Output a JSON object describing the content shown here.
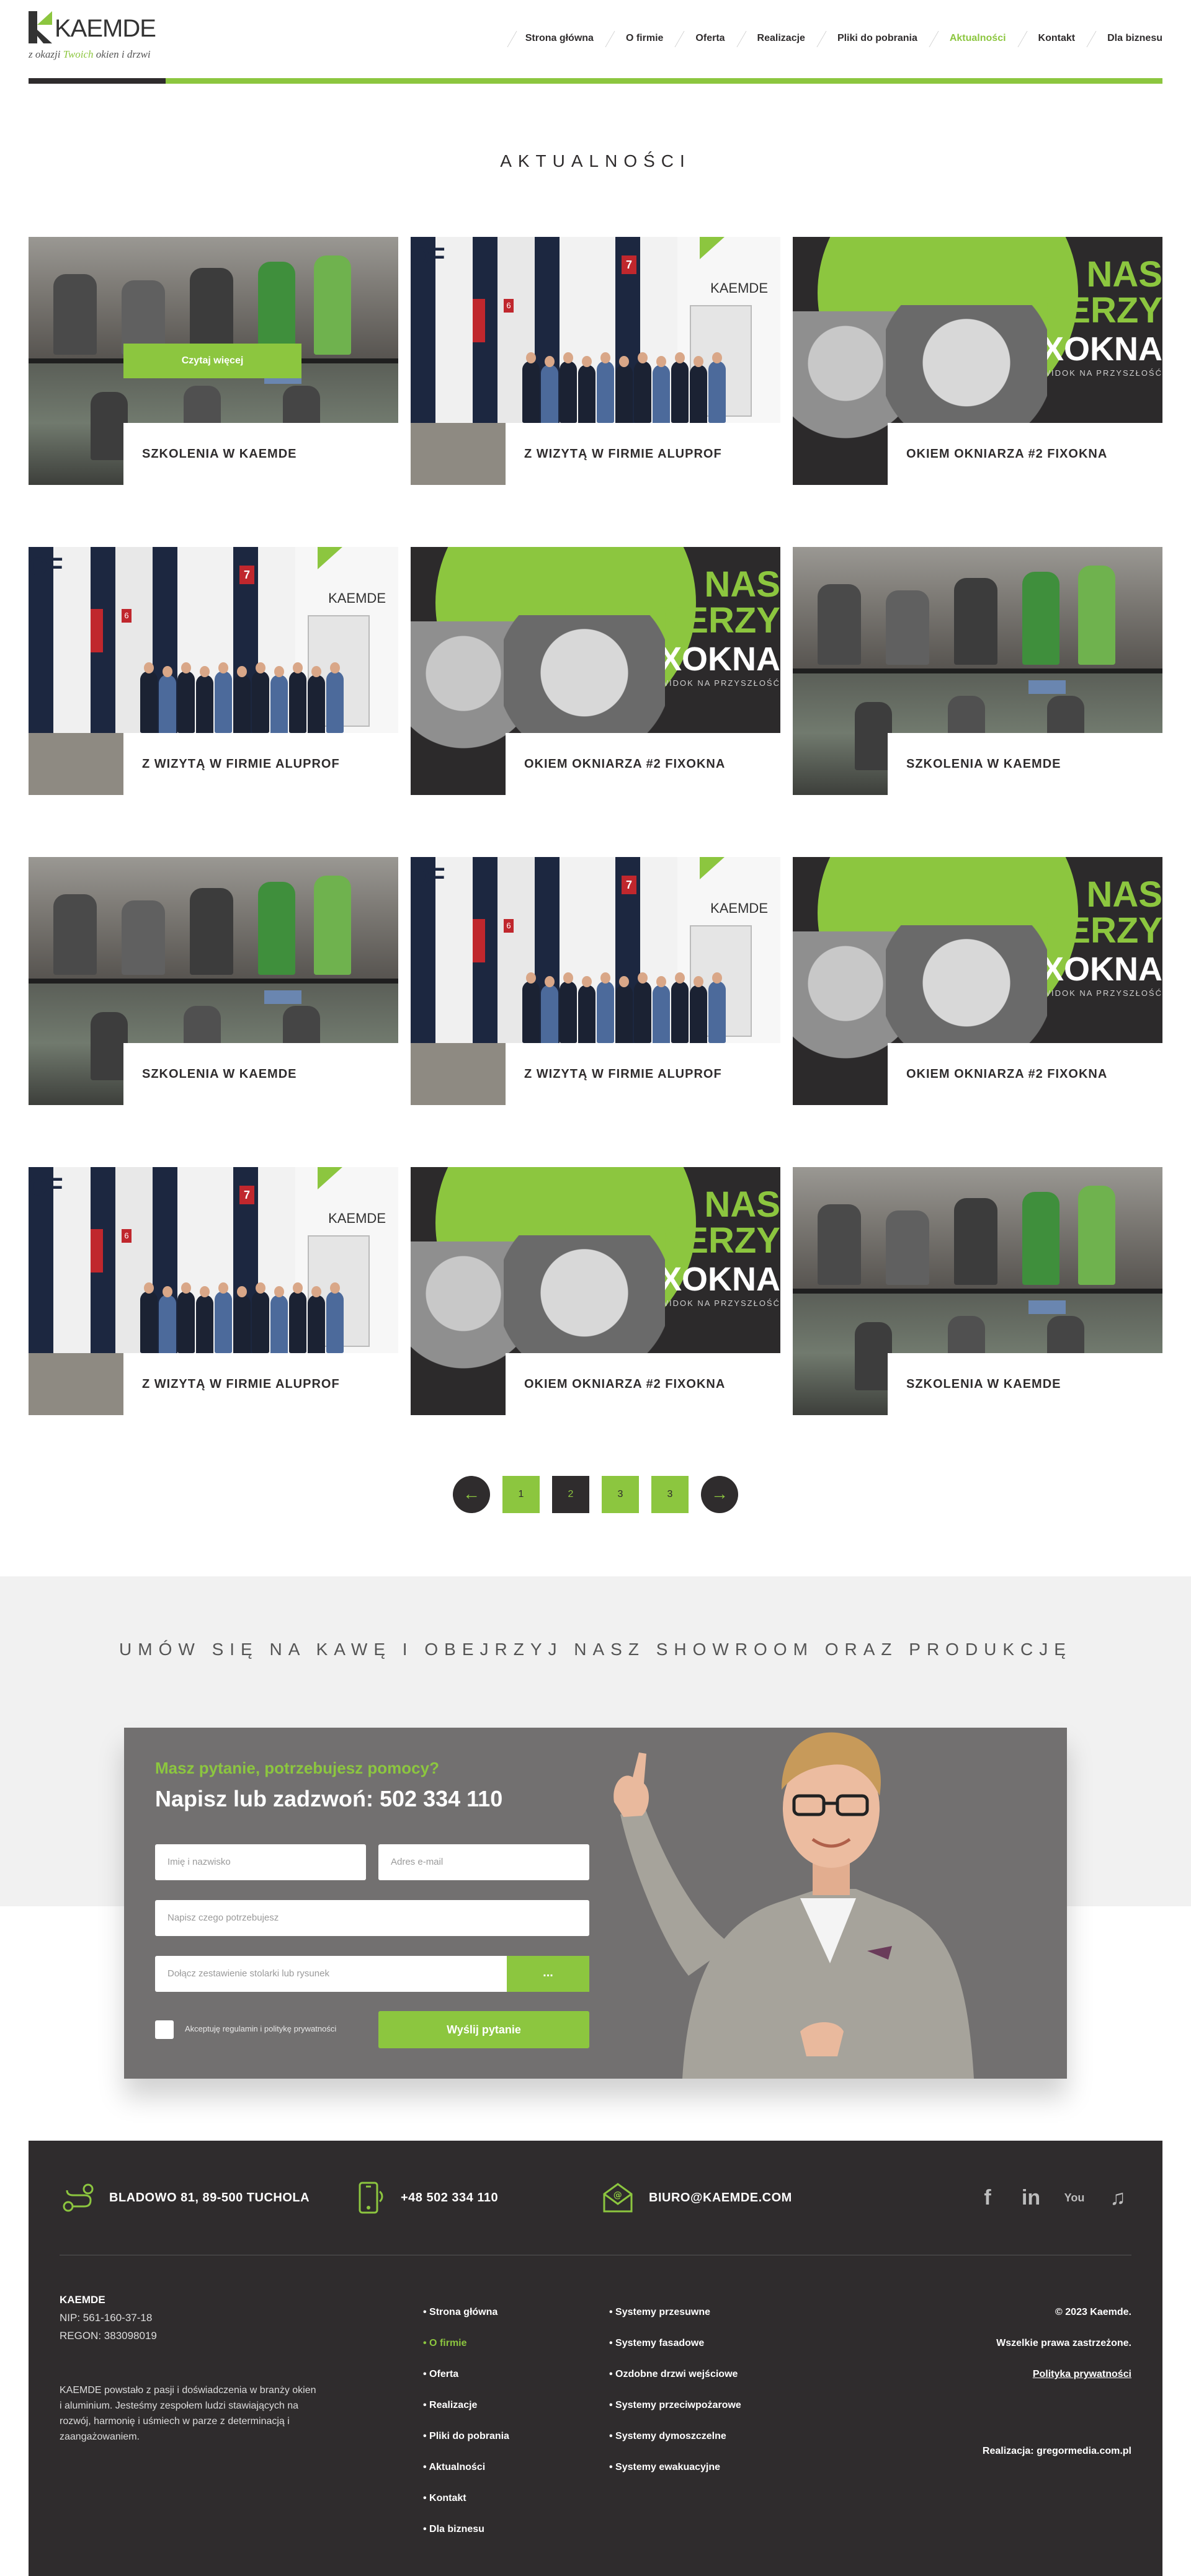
{
  "header": {
    "logo_text": "KAEMDE",
    "logo_tag_pre": "z okazji",
    "logo_tag_accent": "Twoich",
    "logo_tag_post": "okien i drzwi",
    "nav": [
      {
        "label": "Strona główna",
        "active": false
      },
      {
        "label": "O firmie",
        "active": false
      },
      {
        "label": "Oferta",
        "active": false
      },
      {
        "label": "Realizacje",
        "active": false
      },
      {
        "label": "Pliki do pobrania",
        "active": false
      },
      {
        "label": "Aktualności",
        "active": true
      },
      {
        "label": "Kontakt",
        "active": false
      },
      {
        "label": "Dla biznesu",
        "active": false
      }
    ]
  },
  "page_title": "AKTUALNOŚCI",
  "cards": [
    {
      "title": "SZKOLENIA W KAEMDE",
      "image": "training",
      "button": "Czytaj więcej"
    },
    {
      "title": "Z WIZYTĄ W FIRMIE ALUPROF",
      "image": "factory"
    },
    {
      "title": "OKIEM OKNIARZA #2 FIXOKNA",
      "image": "promo"
    },
    {
      "title": "Z WIZYTĄ W FIRMIE ALUPROF",
      "image": "factory"
    },
    {
      "title": "OKIEM OKNIARZA #2 FIXOKNA",
      "image": "promo"
    },
    {
      "title": "SZKOLENIA W KAEMDE",
      "image": "training"
    },
    {
      "title": "SZKOLENIA W KAEMDE",
      "image": "training"
    },
    {
      "title": "Z WIZYTĄ W FIRMIE ALUPROF",
      "image": "factory"
    },
    {
      "title": "OKIEM OKNIARZA #2 FIXOKNA",
      "image": "promo"
    },
    {
      "title": "Z WIZYTĄ W FIRMIE ALUPROF",
      "image": "factory"
    },
    {
      "title": "OKIEM OKNIARZA #2 FIXOKNA",
      "image": "promo"
    },
    {
      "title": "SZKOLENIA W KAEMDE",
      "image": "training"
    }
  ],
  "promo_image": {
    "line1": "NAS",
    "line2": "PARTNERZY",
    "brand": "FIXOKNA",
    "tagline": "BEZPIECZNY WIDOK NA PRZYSZŁOŚĆ"
  },
  "factory_image": {
    "sign_text": "KAEMDE",
    "door_number": "7",
    "door_number_2": "6",
    "wall_text": "OF"
  },
  "pagination": {
    "prev_icon": "arrow-left-icon",
    "next_icon": "arrow-right-icon",
    "pages": [
      "1",
      "2",
      "3",
      "3"
    ],
    "current_index": 1
  },
  "cta": {
    "title": "UMÓW SIĘ NA KAWĘ I OBEJRZYJ NASZ SHOWROOM ORAZ PRODUKCJĘ",
    "subtitle": "Masz pytanie, potrzebujesz pomocy?",
    "heading": "Napisz lub zadzwoń: 502 334 110",
    "name_placeholder": "Imię i nazwisko",
    "email_placeholder": "Adres e-mail",
    "need_placeholder": "Napisz czego potrzebujesz",
    "attach_placeholder": "Dołącz zestawienie stolarki lub rysunek",
    "attach_button": "...",
    "consent_label": "Akceptuję regulamin i politykę prywatności",
    "send_button": "Wyślij pytanie"
  },
  "footer": {
    "address": "BLADOWO 81, 89-500 TUCHOLA",
    "phone": "+48 502 334 110",
    "email": "BIURO@KAEMDE.COM",
    "social": [
      "facebook-icon",
      "linkedin-icon",
      "youtube-icon",
      "tiktok-icon"
    ],
    "company_name": "KAEMDE",
    "nip": "NIP: 561-160-37-18",
    "regon": "REGON: 383098019",
    "description": "KAEMDE powstało z pasji i doświadczenia w branży okien i aluminium. Jesteśmy zespołem ludzi stawiających na rozwój, harmonię i uśmiech w parze z determinacją i zaangażowaniem.",
    "menu": [
      {
        "label": "Strona główna",
        "active": false
      },
      {
        "label": "O firmie",
        "active": true
      },
      {
        "label": "Oferta",
        "active": false
      },
      {
        "label": "Realizacje",
        "active": false
      },
      {
        "label": "Pliki do pobrania",
        "active": false
      },
      {
        "label": "Aktualności",
        "active": false
      },
      {
        "label": "Kontakt",
        "active": false
      },
      {
        "label": "Dla biznesu",
        "active": false
      }
    ],
    "systems": [
      "Systemy przesuwne",
      "Systemy fasadowe",
      "Ozdobne drzwi wejściowe",
      "Systemy przeciwpożarowe",
      "Systemy dymoszczelne",
      "Systemy ewakuacyjne"
    ],
    "copyright": "© 2023 Kaemde.",
    "rights": "Wszelkie prawa zastrzeżone.",
    "privacy": "Polityka prywatności",
    "realization": "Realizacja: gregormedia.com.pl"
  },
  "colors": {
    "accent": "#8cc63f",
    "dark": "#2f2c2d",
    "cta_box": "#727070"
  }
}
